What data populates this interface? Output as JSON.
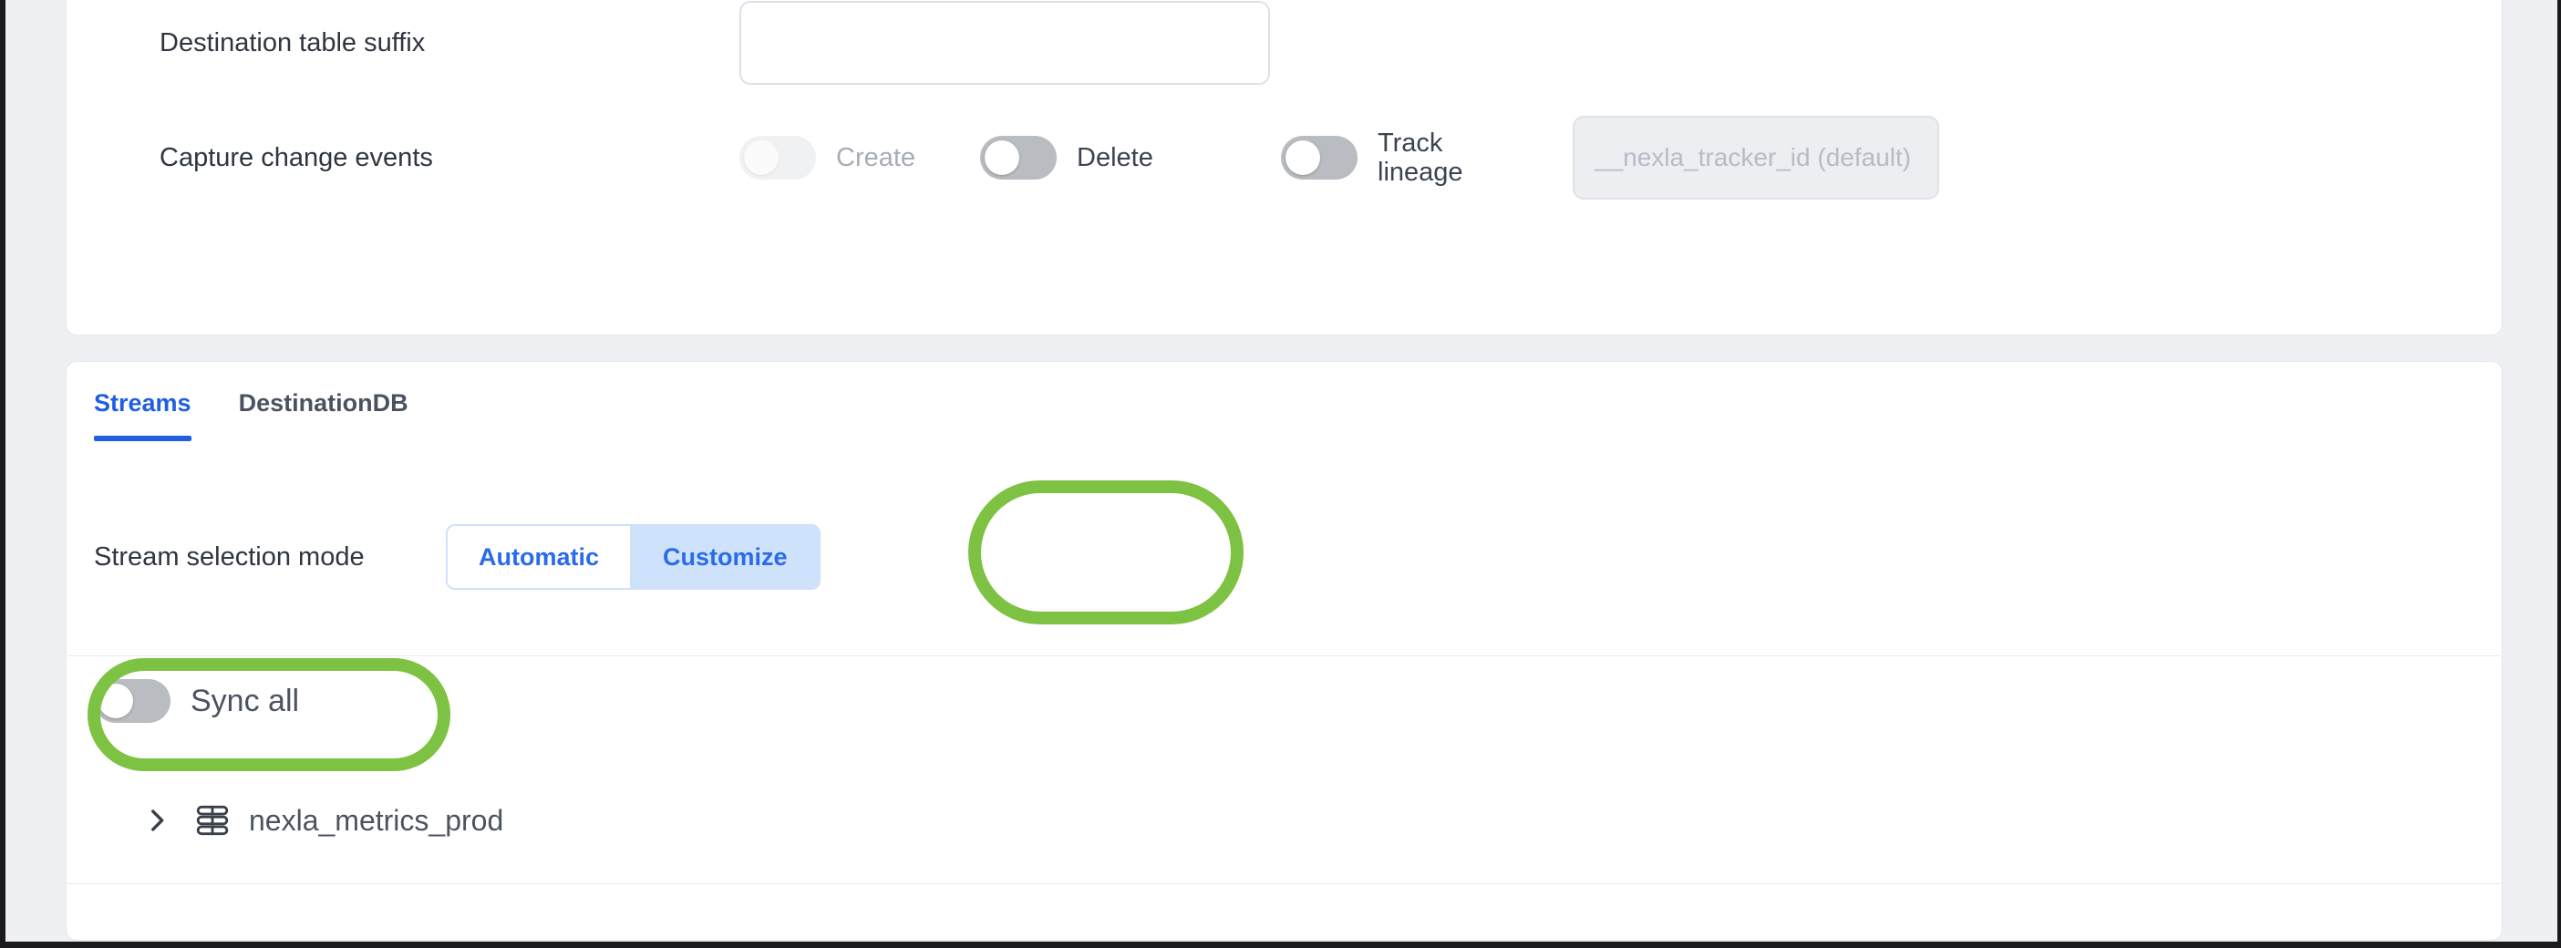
{
  "theme": {
    "accent_blue": "#1f5fe0",
    "segment_selected_bg": "#cfe2fb",
    "annotation_green": "#7dc242",
    "page_bg": "#eef0f3",
    "card_bg": "#ffffff"
  },
  "destination_card": {
    "table_suffix": {
      "label": "Destination table suffix",
      "value": "",
      "placeholder": ""
    },
    "capture_change_events": {
      "label": "Capture change events",
      "toggles": [
        {
          "name": "create",
          "label": "Create",
          "state": "off",
          "style": "faint"
        },
        {
          "name": "delete",
          "label": "Delete",
          "state": "off",
          "style": "grey"
        },
        {
          "name": "track-lineage",
          "label": "Track lineage",
          "state": "off",
          "style": "grey"
        }
      ],
      "tracker_field": {
        "value": "",
        "placeholder": "__nexla_tracker_id (default)",
        "disabled": true
      }
    }
  },
  "streams_card": {
    "tabs": [
      {
        "label": "Streams",
        "active": true
      },
      {
        "label": "DestinationDB",
        "active": false
      }
    ],
    "stream_selection": {
      "label": "Stream selection mode",
      "options": [
        {
          "label": "Automatic",
          "selected": false
        },
        {
          "label": "Customize",
          "selected": true
        }
      ]
    },
    "sync_all": {
      "label": "Sync all",
      "state": "off"
    },
    "tree": [
      {
        "label": "nexla_metrics_prod",
        "expanded": false,
        "chevron": "chevron-right-icon",
        "icon": "database-icon"
      }
    ]
  },
  "annotations": [
    {
      "name": "customize-highlight",
      "target": "Customize",
      "color": "#7dc242",
      "shape": "oval"
    },
    {
      "name": "sync-all-highlight",
      "target": "Sync all",
      "color": "#7dc242",
      "shape": "oval"
    }
  ]
}
